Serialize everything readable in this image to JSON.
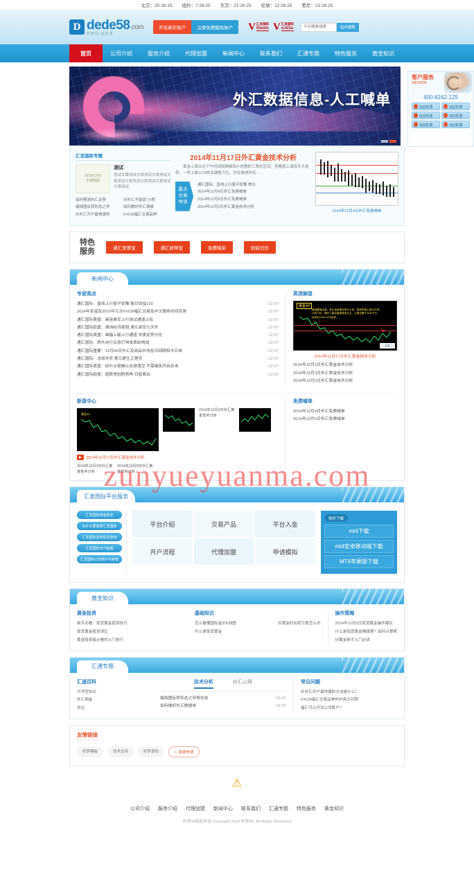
{
  "topbar": {
    "clocks": [
      "北京：20:26:25",
      "纽约：7:26:25",
      "东京：21:26:25",
      "伦敦：12:26:25",
      "悉尼：23:26:25"
    ]
  },
  "header": {
    "logo_mark": "D",
    "logo_main": "dede",
    "logo_num": "58",
    "logo_dotcom": ".com",
    "logo_sub": "织梦码  创享课",
    "btn_real": "开设真实账户",
    "btn_demo": "注册免费模拟账户",
    "partners": [
      {
        "top": "汇发国际",
        "bottom": "0soon"
      },
      {
        "top": "汇发国际",
        "bottom": "ccb1a"
      }
    ],
    "search_placeholder": "今日喊单成绩",
    "search_button": "站内搜索"
  },
  "nav": {
    "items": [
      "首页",
      "公司介绍",
      "服务介绍",
      "代理加盟",
      "新闻中心",
      "联系我们",
      "汇通专题",
      "特色服务",
      "黄金知识"
    ],
    "active_index": 0
  },
  "banner": {
    "title": "外汇数据信息-人工喊单"
  },
  "service_panel": {
    "title": "客户服务",
    "subtitle": "service",
    "phone": "400-6162-125",
    "qq_label": "QQ交谈",
    "qq_count": 6
  },
  "feature": {
    "left_tab": "汇发国际专题",
    "thumb_line1": "DEDECMS",
    "thumb_line2": "无缩略图",
    "article_title": "测试",
    "article_desc": "测试文章测试文章测试文章测试文章测试文章测试文章测试文章测试文章测试...",
    "links": [
      "如何预测外汇走势",
      "炒外汇不能靠“小把",
      "蜡烛图反转形态之孕",
      "如何做好外汇喊单",
      "炒外汇开户最快速的",
      "FXCM福汇交易品种"
    ],
    "head_title": "2014年11月17日外汇黄金技术分析",
    "head_desc": "黄金上周五在下午时间段跌破四小时图的三角形区间，但晚盘上演惊天大逆转，一举上破1178的关键阻力位，并在收线时有...",
    "read_tag": "重点\n文章\n导读",
    "read_tag_lines": [
      "重点",
      "文章",
      "导读"
    ],
    "read_links": [
      "通汇国际：直线上行驱不犹豫 美日",
      "2014年12月4日外汇免费喊单",
      "2014年12月5日外汇免费喊单",
      "2014年12月2日外汇黄金技术分析"
    ],
    "chart_caption": "2014年12月4日外汇免费喊单"
  },
  "special": {
    "label_line1": "特色",
    "label_line2": "服务",
    "buttons": [
      "通汇至尊宝",
      "通汇财神宝",
      "免费喊单",
      "财经日历"
    ]
  },
  "news": {
    "section_title": "新闻中心",
    "expert_title": "专家观点",
    "expert_items": [
      {
        "title": "通汇国际：直线上行驱不犹豫 美日剑指120",
        "date": "12-07"
      },
      {
        "title": "2014年圣诞及2015年元旦FXCM福汇交易及中文服务时间安排",
        "date": "12-07"
      },
      {
        "title": "通汇国际美盘：画苗乘军上行测试通道上轨",
        "date": "12-07"
      },
      {
        "title": "通汇国际欧盘：澳洲经济疲弱 澳元承受九天外",
        "date": "12-07"
      },
      {
        "title": "通汇国际美盘：画幅上破上行通道 非美走势分化",
        "date": "12-07"
      },
      {
        "title": "通汇国际：两大央行议息打响本周前哨战",
        "date": "12-07"
      },
      {
        "title": "通汇国际重要：12月05日外汇及商品市场各日回顾和今日单",
        "date": "12-07"
      },
      {
        "title": "通汇国际：决战非农 美元是生正是死",
        "date": "12-07"
      },
      {
        "title": "通汇国际美盘：纺叶止损确认反弹落空 不需被拓开启反击",
        "date": "12-07"
      },
      {
        "title": "通汇国际欧盘：超跌常因附势再 日欧弗出",
        "date": "12-07"
      }
    ],
    "hd_title": "高清解盘",
    "hd_chart_label": "黄金4H",
    "hd_chart_note": "黄金震荡走高，多头连续增仓参与上攻，短线有望上测1200关口压力位，操作上建议逢低做多为主。止损设置于1180下方，目标位1205-1215区间。",
    "hd_caption": "2014年11月17日外汇黄金技术分析",
    "hd_items": [
      "2014年12月2日外汇黄金技术分析",
      "2014年12月3日外汇黄金技术分析",
      "2014年12月5日外汇黄金技术分析"
    ],
    "video_title": "新盘中心",
    "video_big_caption": "2014年11月17日外汇黄金技术分析",
    "video_sm_caps": [
      "2014年12月2日外汇黄金技术分析",
      "2014年12月3日外汇黄金技术分析",
      "2014年12月5日外汇黄金技术分析"
    ],
    "free_title": "免费喊单",
    "free_items": [
      "2014年12月4日外汇免费喊单",
      "2014年12月5日外汇免费喊单"
    ]
  },
  "platform": {
    "section_title": "汇发国际平台服务",
    "side_items": [
      "汇发国际资金安全",
      "为什么要选择汇发国际",
      "汇发国际监管信息查询",
      "汇发国际开户指南",
      "汇发国际公司简介与荣誉"
    ],
    "grid": [
      "平台介绍",
      "交易产品",
      "平台入金",
      "开户流程",
      "代理加盟",
      "申请模拟"
    ],
    "dl_title": "软件下载",
    "dl_buttons": [
      "mt4下载",
      "mt4安卓移动端下载",
      "MT4苹果版下载"
    ]
  },
  "gold": {
    "section_title": "黄金知识",
    "col1_title": "黄金投资",
    "col1_links": [
      "新手必看：现货黄金投资技巧",
      "现货黄金投资误区",
      "黄金投资者必看的入门技巧"
    ],
    "col2_title": "基础知识",
    "col2_links_a": [
      "怎么看懂国际金价K线图",
      "什么是现货黄金"
    ],
    "col2_links_b": [
      "炒黄金时出现亏损怎么办"
    ],
    "col3_title": "操作策略",
    "col3_links": [
      "2014年12月5日现货黄金操作建议",
      "什么是现货黄金稀疏费？如何计算呢",
      "炒黄金新手入门必读"
    ]
  },
  "huitong": {
    "section_title": "汇通专题",
    "col1_title": "汇通百科",
    "col1_links": [
      "卢浮宫协议",
      "外汇佣金",
      "仓位"
    ],
    "tabs": [
      "技术分析",
      "炒汇心得"
    ],
    "active_tab": 0,
    "tab_items": [
      {
        "title": "蜡烛图反转形态之孕育形态",
        "date": "12-07"
      },
      {
        "title": "如何做好外汇数据单",
        "date": "12-07"
      }
    ],
    "col3_title": "常见问题",
    "col3_links": [
      "炒外汇开户最快捷的方法是什么？",
      "FXCM福汇交易品种的中英文对照",
      "福汇可以开设公司账户？"
    ]
  },
  "friend_links": {
    "title": "友情链接",
    "chips": [
      "织梦模板",
      "技术支持",
      "织梦源码"
    ],
    "apply": "友链申请",
    "apply_plus": "+"
  },
  "footer": {
    "warn_icon": "⚠",
    "nav": [
      "公司介绍",
      "服务介绍",
      "代理加盟",
      "新闻中心",
      "联系我们",
      "汇通专题",
      "特色服务",
      "黄金知识"
    ],
    "copyright": "织梦58版权所有 Copyright 2014 织梦58. All Rights Reserved"
  },
  "watermark": {
    "text": "zunyueyuanma.com"
  }
}
